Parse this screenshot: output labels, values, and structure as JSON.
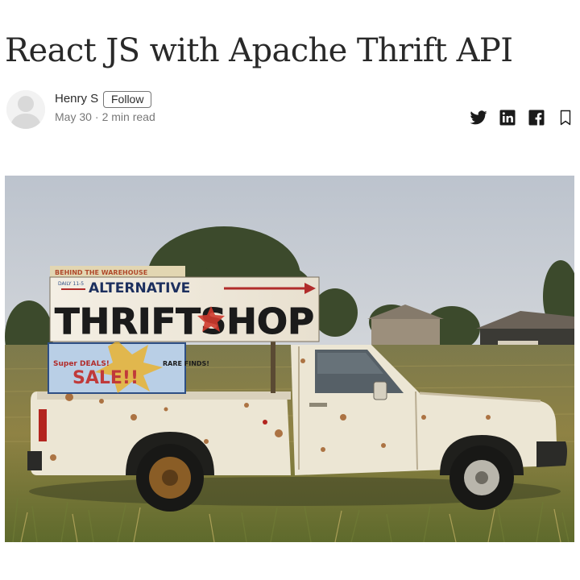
{
  "article": {
    "title": "React JS with Apache Thrift API",
    "author": "Henry S",
    "follow_label": "Follow",
    "date": "May 30",
    "separator": "·",
    "read_time": "2 min read"
  },
  "share_icons": [
    "twitter-icon",
    "linkedin-icon",
    "facebook-icon",
    "bookmark-icon"
  ],
  "hero_image": {
    "alt": "Rusty white pickup truck in a field with ALTERNATIVE THRIFT SHOP sign",
    "sign": {
      "top_strip": "BEHIND THE WAREHOUSE",
      "line1": "ALTERNATIVE",
      "line2": "THRIFTSHOP",
      "small": "DAILY 11-5",
      "side_left": "Super DEALS!",
      "side_right": "RARE FINDS!",
      "sale": "SALE!!"
    }
  },
  "colors": {
    "text_primary": "#292929",
    "text_secondary": "#757575",
    "sky": "#c9ced6",
    "field": "#8a7a3e",
    "truck_white": "#ece6d6",
    "rust": "#a8632a"
  }
}
